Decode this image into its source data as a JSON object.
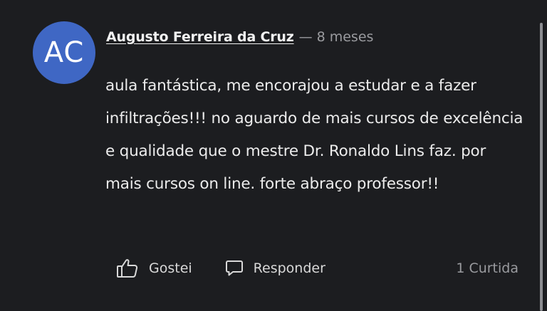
{
  "comment": {
    "avatar_initials": "AC",
    "avatar_color": "#3f67c4",
    "author": "Augusto Ferreira da Cruz",
    "separator": "—",
    "age": "8 meses",
    "text": "aula fantástica, me encorajou a estudar e a fazer infiltrações!!! no aguardo de mais cursos de excelência e qualidade que o mestre Dr. Ronaldo Lins faz. por mais cursos on line. forte abraço professor!!",
    "actions": {
      "like_label": "Gostei",
      "like_icon": "thumbs-up-icon",
      "reply_label": "Responder",
      "reply_icon": "speech-bubble-icon",
      "likes_count": "1 Curtida"
    }
  },
  "theme": {
    "background": "#1c1d20",
    "text": "#ececec",
    "muted": "#9a9b9f"
  }
}
